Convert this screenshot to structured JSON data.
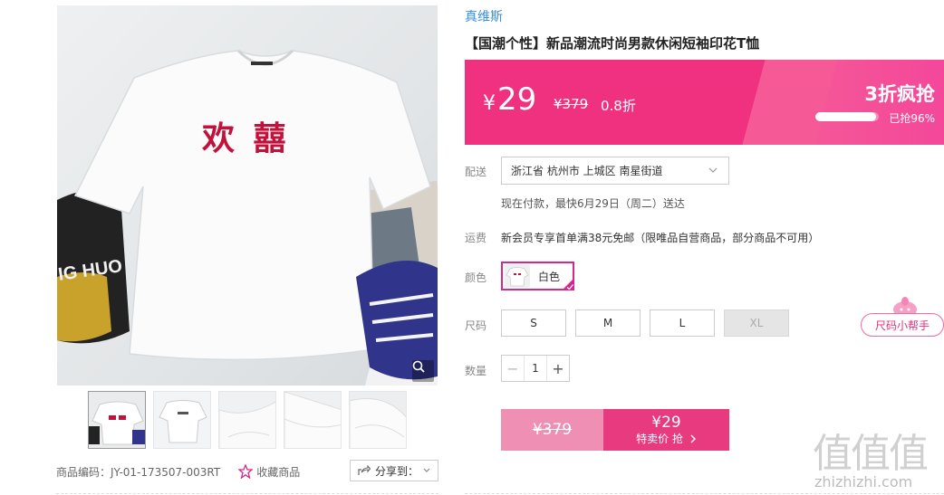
{
  "product": {
    "brand": "真维斯",
    "title": "【国潮个性】新品潮流时尚男款休闲短袖印花T恤",
    "main_image_print": "欢 囍",
    "code_label": "商品编码：JY-01-173507-003RT",
    "favorite_label": "收藏商品",
    "share_label": "分享到：",
    "thumbnail_count": 5
  },
  "price_bar": {
    "currency": "¥",
    "price": "29",
    "original_price": "¥379",
    "discount": "0.8折",
    "flash_title": "3折疯抢",
    "sold_text": "已抢96%",
    "sold_percent": 96,
    "colors": {
      "main": "#f0317f",
      "panel": "#f55a97"
    }
  },
  "delivery": {
    "label": "配送",
    "address": "浙江省 杭州市 上城区 南星街道",
    "eta": "现在付款，最快6月29日（周二）送达"
  },
  "freight": {
    "label": "运费",
    "text": "新会员专享首单满38元免邮（限唯品自营商品，部分商品不可用）"
  },
  "color": {
    "label": "颜色",
    "selected": "白色",
    "accent": "#d6278b"
  },
  "size": {
    "label": "尺码",
    "options": [
      {
        "label": "S",
        "available": true
      },
      {
        "label": "M",
        "available": true
      },
      {
        "label": "L",
        "available": true
      },
      {
        "label": "XL",
        "available": false
      }
    ],
    "helper_label": "尺码小帮手"
  },
  "quantity": {
    "label": "数量",
    "value": "1",
    "minus": "−",
    "plus": "+"
  },
  "buy": {
    "original": "¥379",
    "price": "¥29",
    "action": "特卖价 抢"
  },
  "watermark": {
    "logo": "值值值",
    "url": "zhizhizhi.com"
  }
}
